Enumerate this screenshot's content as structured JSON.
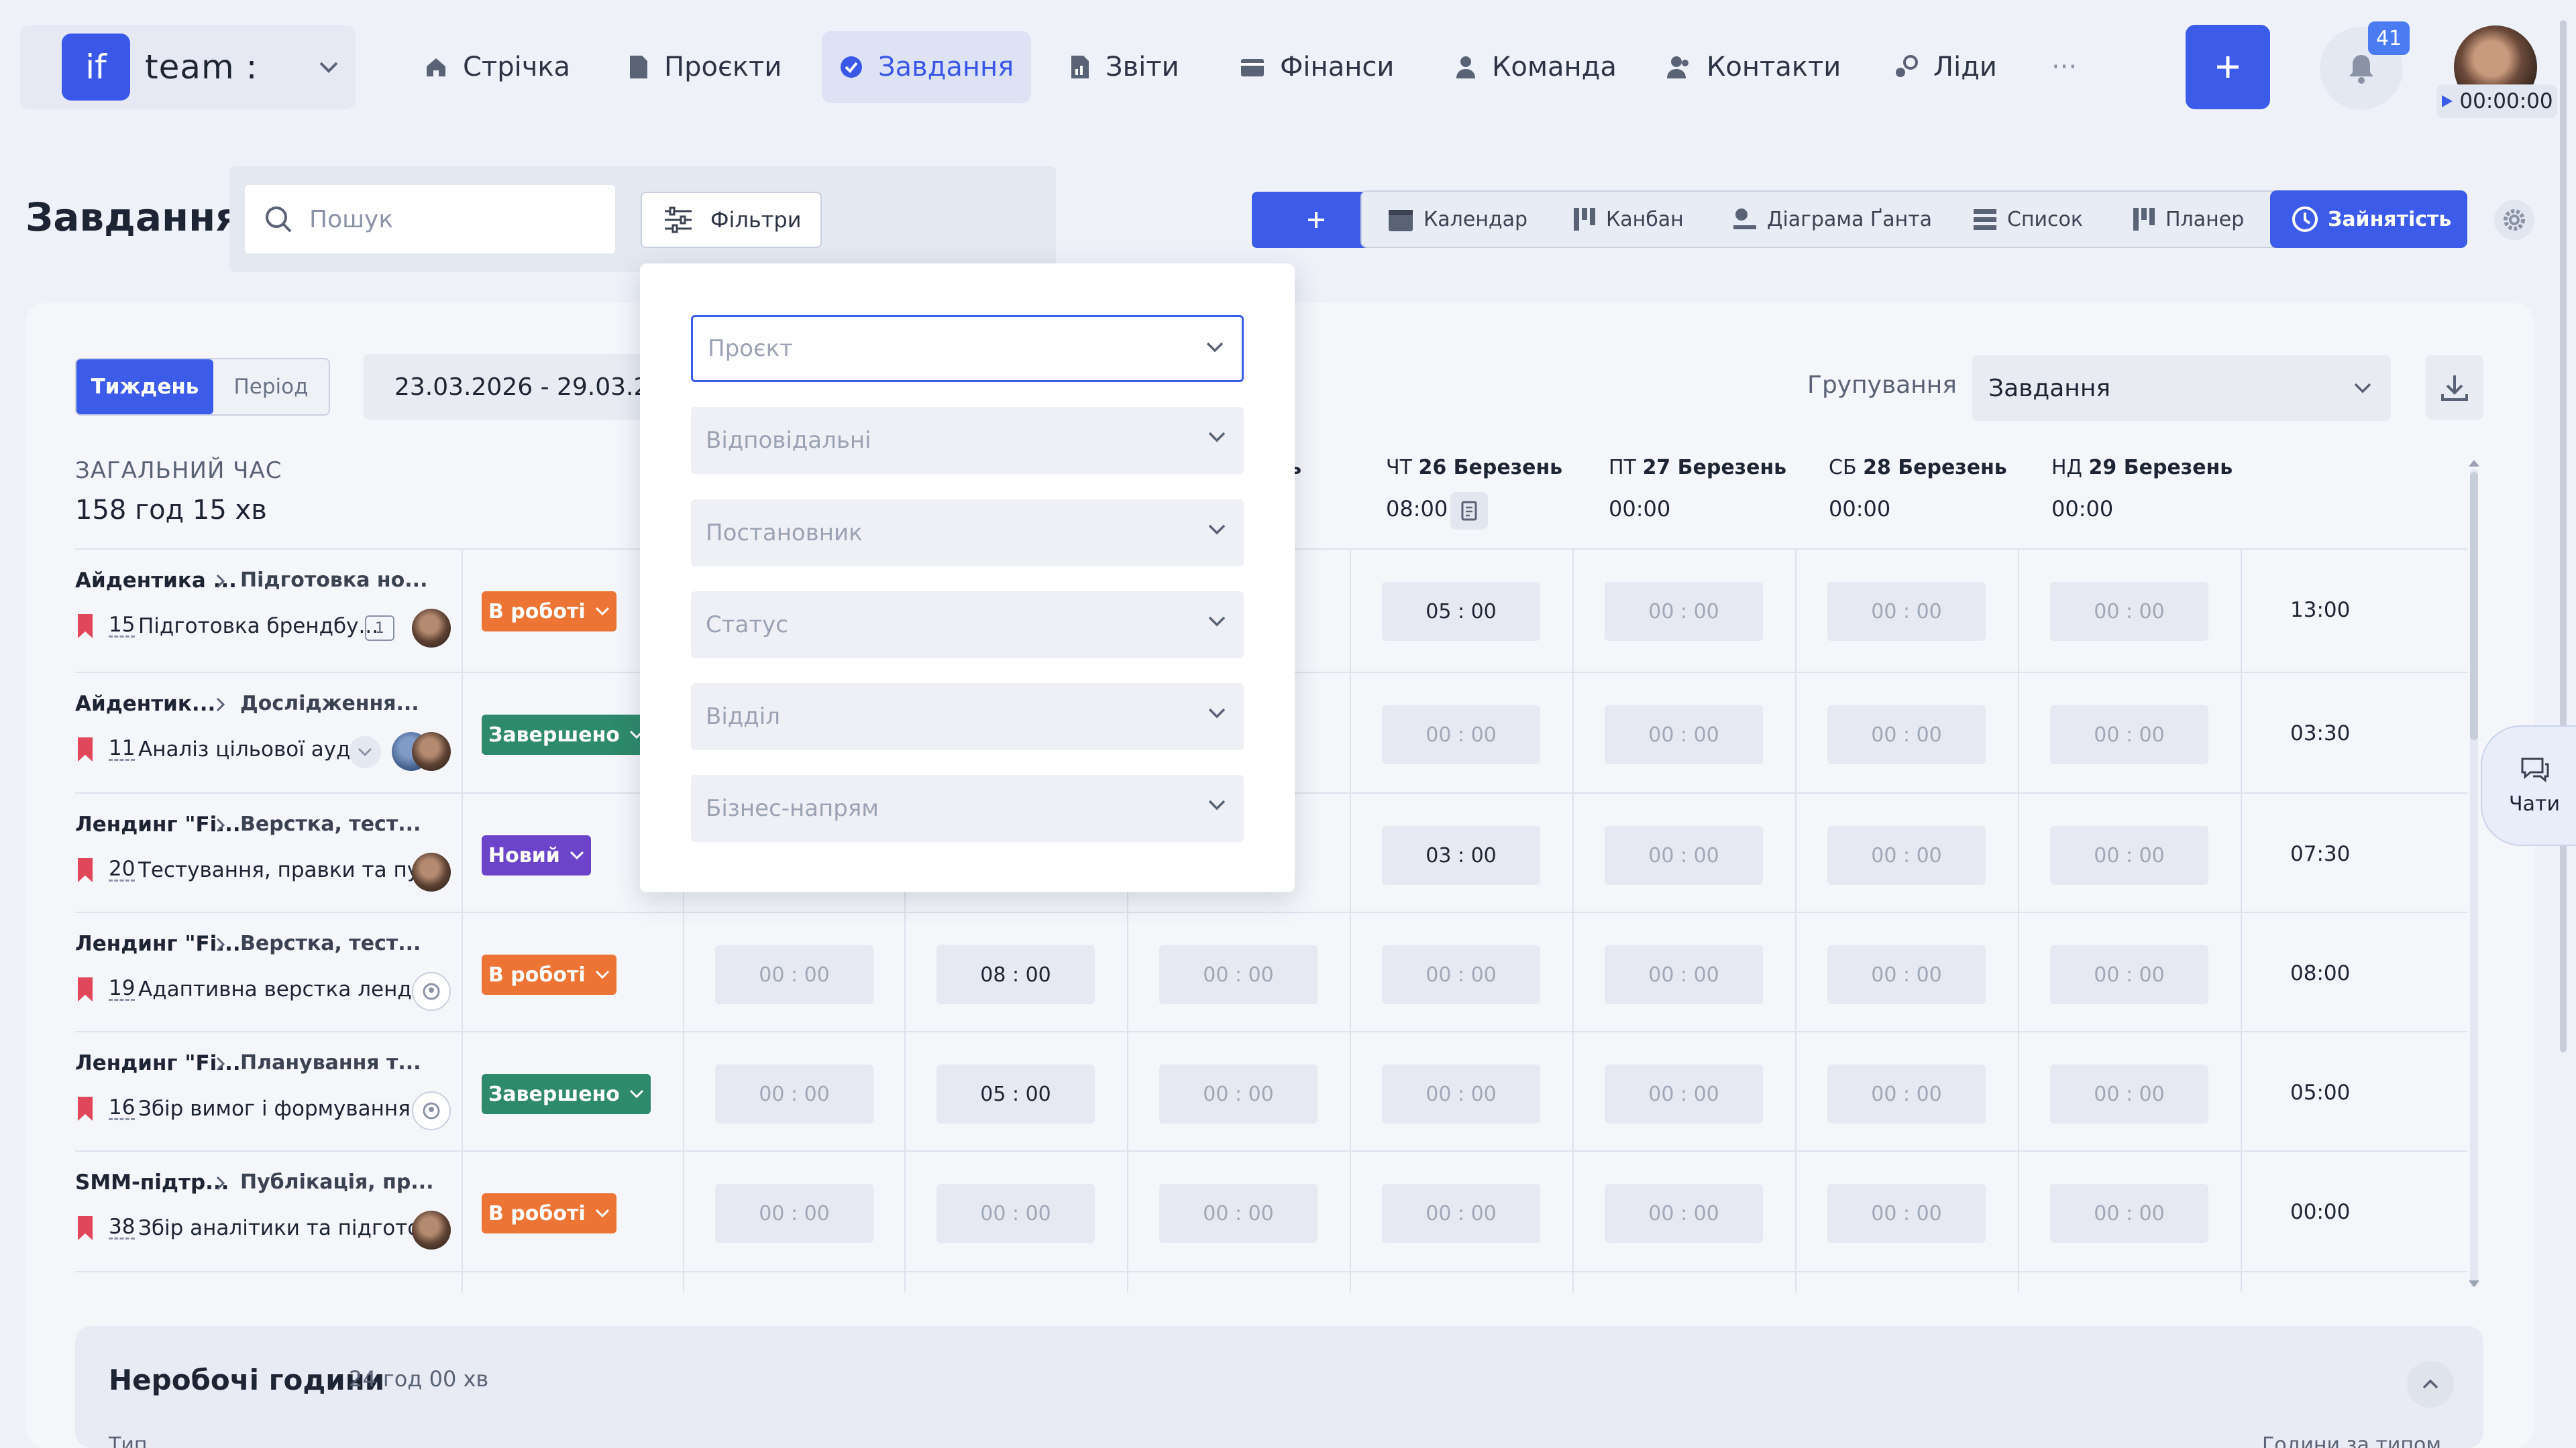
{
  "app": {
    "logo_text": "if",
    "team_name": "team :"
  },
  "nav": [
    {
      "label": "Стрічка",
      "icon": "home-icon"
    },
    {
      "label": "Проєкти",
      "icon": "document-icon"
    },
    {
      "label": "Завдання",
      "icon": "check-circle-icon",
      "active": true
    },
    {
      "label": "Звіти",
      "icon": "report-icon"
    },
    {
      "label": "Фінанси",
      "icon": "wallet-icon"
    },
    {
      "label": "Команда",
      "icon": "person-icon"
    },
    {
      "label": "Контакти",
      "icon": "contacts-icon"
    },
    {
      "label": "Ліди",
      "icon": "leads-icon"
    },
    {
      "label": "···",
      "icon": "more-icon"
    }
  ],
  "notifications": {
    "count": "41"
  },
  "timer": "00:00:00",
  "page": {
    "title": "Завдання"
  },
  "search": {
    "placeholder": "Пошук"
  },
  "filters": {
    "label": "Фільтри",
    "fields": [
      "Проєкт",
      "Відповідальні",
      "Постановник",
      "Статус",
      "Відділ",
      "Бізнес-напрям"
    ]
  },
  "views": [
    {
      "label": "Календар",
      "icon": "calendar-icon"
    },
    {
      "label": "Канбан",
      "icon": "kanban-icon"
    },
    {
      "label": "Діаграма Ґанта",
      "icon": "gantt-icon"
    },
    {
      "label": "Список",
      "icon": "list-icon"
    },
    {
      "label": "Планер",
      "icon": "planner-icon"
    },
    {
      "label": "Зайнятість",
      "icon": "clock-icon",
      "active": true
    }
  ],
  "period": {
    "week": "Тиждень",
    "range": "Період",
    "dates": "23.03.2026 - 29.03.2026"
  },
  "grouping": {
    "label": "Групування",
    "value": "Завдання"
  },
  "total": {
    "label": "ЗАГАЛЬНИЙ ЧАС",
    "value": "158 год 15 хв"
  },
  "days": [
    {
      "dow": "",
      "date": "ень",
      "time": ""
    },
    {
      "dow": "ЧТ",
      "date": "26 Березень",
      "time": "08:00"
    },
    {
      "dow": "ПТ",
      "date": "27 Березень",
      "time": "00:00"
    },
    {
      "dow": "СБ",
      "date": "28 Березень",
      "time": "00:00"
    },
    {
      "dow": "НД",
      "date": "29 Березень",
      "time": "00:00"
    }
  ],
  "rows": [
    {
      "project": "Айдентика ...",
      "stage": "Підготовка но...",
      "num": "15",
      "task": "Підготовка брендбу...",
      "status": "В роботі",
      "status_type": "work",
      "cells": [
        "",
        "",
        "",
        "05 : 00",
        "00 : 00",
        "00 : 00",
        "00 : 00"
      ],
      "total": "13:00"
    },
    {
      "project": "Айдентик...",
      "stage": "Дослідження...",
      "num": "11",
      "task": "Аналіз цільової ауд...",
      "status": "Завершено",
      "status_type": "done",
      "cells": [
        "",
        "",
        "",
        "00 : 00",
        "00 : 00",
        "00 : 00",
        "00 : 00"
      ],
      "total": "03:30"
    },
    {
      "project": "Лендинг \"Fi...",
      "stage": "Верстка, тест...",
      "num": "20",
      "task": "Тестування, правки та пу...",
      "status": "Новий",
      "status_type": "new",
      "cells": [
        "",
        "",
        "",
        "03 : 00",
        "00 : 00",
        "00 : 00",
        "00 : 00"
      ],
      "total": "07:30"
    },
    {
      "project": "Лендинг \"Fi...",
      "stage": "Верстка, тест...",
      "num": "19",
      "task": "Адаптивна верстка ленди...",
      "status": "В роботі",
      "status_type": "work",
      "cells": [
        "00 : 00",
        "08 : 00",
        "00 : 00",
        "00 : 00",
        "00 : 00",
        "00 : 00",
        "00 : 00"
      ],
      "total": "08:00"
    },
    {
      "project": "Лендинг \"Fi...",
      "stage": "Планування т...",
      "num": "16",
      "task": "Збір вимог і формування ...",
      "status": "Завершено",
      "status_type": "done",
      "cells": [
        "00 : 00",
        "05 : 00",
        "00 : 00",
        "00 : 00",
        "00 : 00",
        "00 : 00",
        "00 : 00"
      ],
      "total": "05:00"
    },
    {
      "project": "SMM-підтр...",
      "stage": "Публікація, пр...",
      "num": "38",
      "task": "Збір аналітики та підгото...",
      "status": "В роботі",
      "status_type": "work",
      "cells": [
        "00 : 00",
        "00 : 00",
        "00 : 00",
        "00 : 00",
        "00 : 00",
        "00 : 00",
        "00 : 00"
      ],
      "total": "00:00"
    }
  ],
  "off_hours": {
    "title": "Неробочі години",
    "value": "24 год 00 хв",
    "col_type": "Тип",
    "col_hours": "Години за типом"
  },
  "chat": {
    "label": "Чати"
  },
  "colors": {
    "accent": "#3b5be8",
    "status_work": "#ec7535",
    "status_done": "#2e8a6a",
    "status_new": "#6c44c9"
  }
}
